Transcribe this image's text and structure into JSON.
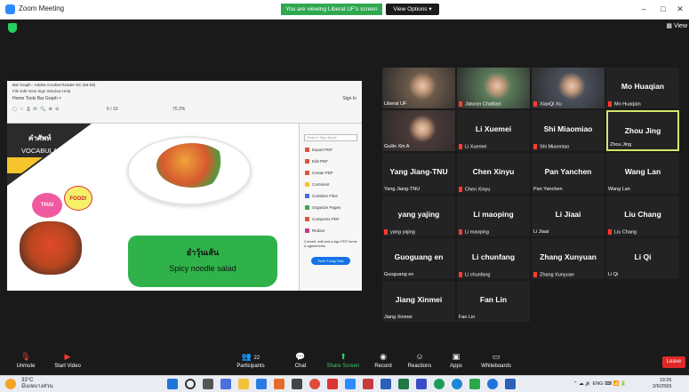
{
  "window": {
    "title": "Zoom Meeting",
    "share_banner": "You are viewing Liberal UF's screen",
    "view_options": "View Options ▾",
    "view_btn": "View"
  },
  "shared": {
    "pdf_title": "Bar Graph - Adobe Acrobat Reader DC (64-bit)",
    "pdf_menu": "File  Edit  View  Sign  Window  Help",
    "pdf_tabs": "Home   Tools          Bar Graph   ×",
    "sign_in": "Sign In",
    "page_no": "6  / 10",
    "zoom": "70.2%",
    "slide": {
      "vocab_th": "คำศัพท์",
      "vocab_en": "VOCABULAR",
      "thai": "THAI",
      "food": "FOOD!",
      "dish_th": "ยำวุ้นเส้น",
      "dish_en": "Spicy noodle salad"
    },
    "tools": {
      "search_placeholder": "Search 'Sign Mode'",
      "items": [
        "Export PDF",
        "Edit PDF",
        "Create PDF",
        "Comment",
        "Combine Files",
        "Organize Pages",
        "Compress PDF",
        "Redact"
      ],
      "promo": "Convert, edit and e-sign PDF forms & agreements",
      "trial": "Free 7-Day Trial"
    }
  },
  "participants": [
    {
      "name": "",
      "label": "Liberal UF",
      "muted": false,
      "video": true
    },
    {
      "name": "",
      "label": "Jaturon Chatban",
      "muted": true,
      "video": true
    },
    {
      "name": "",
      "label": "XiaoQi Xu",
      "muted": true,
      "video": true
    },
    {
      "name": "Mo Huaqian",
      "label": "Mo Huaqian",
      "muted": true,
      "video": false
    },
    {
      "name": "",
      "label": "Guilin Xin A",
      "muted": false,
      "video": true
    },
    {
      "name": "Li Xuemei",
      "label": "Li Xuemei",
      "muted": true,
      "video": false
    },
    {
      "name": "Shi Miaomiao",
      "label": "Shi Miaomiao",
      "muted": true,
      "video": false
    },
    {
      "name": "Zhou Jing",
      "label": "Zhou Jing",
      "muted": false,
      "video": false,
      "active": true
    },
    {
      "name": "Yang Jiang-TNU",
      "label": "Yang Jiang-TNU",
      "muted": false,
      "video": false
    },
    {
      "name": "Chen Xinyu",
      "label": "Chen Xinyu",
      "muted": true,
      "video": false
    },
    {
      "name": "Pan Yanchen",
      "label": "Pan Yanchen",
      "muted": false,
      "video": false
    },
    {
      "name": "Wang Lan",
      "label": "Wang Lan",
      "muted": false,
      "video": false
    },
    {
      "name": "yang yajing",
      "label": "yang yajing",
      "muted": true,
      "video": false
    },
    {
      "name": "Li maoping",
      "label": "Li maoping",
      "muted": true,
      "video": false
    },
    {
      "name": "Li Jiaai",
      "label": "Li Jiaai",
      "muted": false,
      "video": false
    },
    {
      "name": "Liu Chang",
      "label": "Liu Chang",
      "muted": true,
      "video": false
    },
    {
      "name": "Guoguang en",
      "label": "Guoguang en",
      "muted": false,
      "video": false
    },
    {
      "name": "Li chunfang",
      "label": "Li chunfang",
      "muted": true,
      "video": false
    },
    {
      "name": "Zhang Xunyuan",
      "label": "Zhang Xunyuan",
      "muted": true,
      "video": false
    },
    {
      "name": "Li Qi",
      "label": "Li Qi",
      "muted": false,
      "video": false
    },
    {
      "name": "Jiang Xinmei",
      "label": "Jiang Xinmei",
      "muted": false,
      "video": false
    },
    {
      "name": "Fan Lin",
      "label": "Fan Lin",
      "muted": false,
      "video": false
    }
  ],
  "toolbar": {
    "unmute": "Unmute",
    "start_video": "Start Video",
    "participants": "Participants",
    "participants_count": "22",
    "chat": "Chat",
    "share_screen": "Share Screen",
    "record": "Record",
    "reactions": "Reactions",
    "apps": "Apps",
    "whiteboards": "Whiteboards",
    "leave": "Leave"
  },
  "taskbar": {
    "temp": "33°C",
    "weather": "มีเมฆบางส่วน",
    "lang": "ENG",
    "time": "19:26",
    "date": "2/6/2565"
  },
  "colors": {
    "accent_green": "#2fa84f",
    "leave_red": "#e02828",
    "active_border": "#d8e66a",
    "muted_red": "#ff3b30"
  }
}
